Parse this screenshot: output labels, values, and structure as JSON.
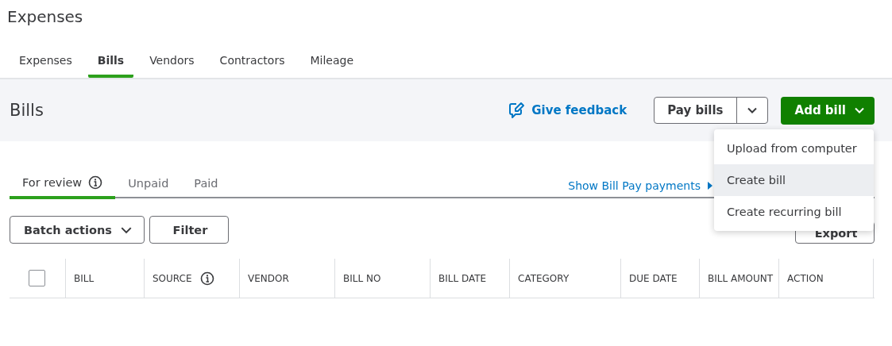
{
  "page_title": "Expenses",
  "tabs": [
    {
      "label": "Expenses",
      "selected": false
    },
    {
      "label": "Bills",
      "selected": true
    },
    {
      "label": "Vendors",
      "selected": false
    },
    {
      "label": "Contractors",
      "selected": false
    },
    {
      "label": "Mileage",
      "selected": false
    }
  ],
  "header": {
    "title": "Bills",
    "feedback": "Give feedback",
    "pay_bills": "Pay bills",
    "add_bill": "Add bill"
  },
  "add_bill_menu": [
    {
      "label": "Upload from computer",
      "selected": false
    },
    {
      "label": "Create bill",
      "selected": true
    },
    {
      "label": "Create recurring bill",
      "selected": false
    }
  ],
  "sub_tabs": [
    {
      "label": "For review",
      "selected": true,
      "info": true
    },
    {
      "label": "Unpaid",
      "selected": false,
      "info": false
    },
    {
      "label": "Paid",
      "selected": false,
      "info": false
    }
  ],
  "bill_pay_link": "Show Bill Pay payments",
  "toolbar": {
    "batch_actions": "Batch actions",
    "filter": "Filter",
    "export": "Export"
  },
  "table": {
    "select_all_checked": false,
    "columns": [
      {
        "label": "BILL",
        "info": false
      },
      {
        "label": "SOURCE",
        "info": true
      },
      {
        "label": "VENDOR",
        "info": false
      },
      {
        "label": "BILL NO",
        "info": false
      },
      {
        "label": "BILL DATE",
        "info": false
      },
      {
        "label": "CATEGORY",
        "info": false
      },
      {
        "label": "DUE DATE",
        "info": false
      },
      {
        "label": "BILL AMOUNT",
        "info": false
      },
      {
        "label": "ACTION",
        "info": false
      }
    ]
  }
}
